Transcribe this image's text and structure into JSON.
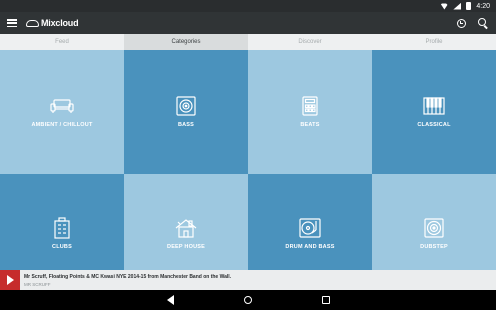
{
  "status_bar": {
    "time": "4:20"
  },
  "app": {
    "name": "Mixcloud"
  },
  "tabs": [
    {
      "label": "Feed",
      "active": false
    },
    {
      "label": "Categories",
      "active": true
    },
    {
      "label": "Discover",
      "active": false
    },
    {
      "label": "Profile",
      "active": false
    }
  ],
  "categories": [
    {
      "label": "AMBIENT / CHILLOUT",
      "icon": "sofa-icon"
    },
    {
      "label": "BASS",
      "icon": "speaker-icon"
    },
    {
      "label": "BEATS",
      "icon": "sampler-icon"
    },
    {
      "label": "CLASSICAL",
      "icon": "piano-icon"
    },
    {
      "label": "CLUBS",
      "icon": "building-icon"
    },
    {
      "label": "DEEP HOUSE",
      "icon": "house-icon"
    },
    {
      "label": "DRUM AND BASS",
      "icon": "turntable-icon"
    },
    {
      "label": "DUBSTEP",
      "icon": "subwoofer-icon"
    }
  ],
  "colors": {
    "tile_light": "#9dc8e0",
    "tile_dark": "#4a92bd",
    "toolbar": "#303436",
    "player_art": "#c62c2c"
  },
  "player": {
    "title": "Mr Scruff, Floating Points & MC Kwasi NYE 2014-15 from Manchester Band on the Wall.",
    "artist": "MR SCRUFF"
  }
}
